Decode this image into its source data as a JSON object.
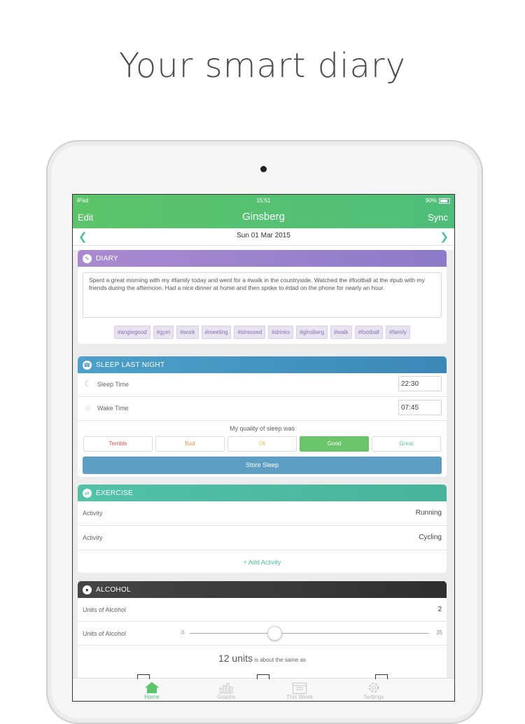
{
  "headline": "Your smart diary",
  "status_bar": {
    "carrier": "iPad",
    "time": "15:51",
    "battery": "90%"
  },
  "nav": {
    "edit": "Edit",
    "title": "Ginsberg",
    "sync": "Sync",
    "date": "Sun 01 Mar 2015"
  },
  "diary": {
    "title": "DIARY",
    "text": "Spent a great morning with my #family today and went for a #walk in the countryside. Watched the #football at the #pub with my friends during the afternoon. Had a nice dinner at home and then spoke to #dad on the phone for nearly an hour.",
    "tags": [
      "#angiegood",
      "#gym",
      "#work",
      "#meeting",
      "#stressed",
      "#drinks",
      "#ginsberg",
      "#walk",
      "#football",
      "#family"
    ]
  },
  "sleep": {
    "title": "SLEEP LAST NIGHT",
    "sleep_time_label": "Sleep Time",
    "sleep_time": "22:30",
    "wake_time_label": "Wake Time",
    "wake_time": "07:45",
    "quality_label": "My quality of sleep was",
    "options": [
      {
        "label": "Terrible",
        "color": "#d9534f",
        "selected": false
      },
      {
        "label": "Bad",
        "color": "#e89a4a",
        "selected": false
      },
      {
        "label": "Ok",
        "color": "#d6c94a",
        "selected": false
      },
      {
        "label": "Good",
        "color": "#6cc46a",
        "selected": true
      },
      {
        "label": "Great",
        "color": "#5cbf9a",
        "selected": false
      }
    ],
    "store_button": "Store Sleep"
  },
  "exercise": {
    "title": "EXERCISE",
    "activities": [
      {
        "label": "Activity",
        "value": "Running"
      },
      {
        "label": "Activity",
        "value": "Cycling"
      }
    ],
    "add_activity": "+ Add Activity"
  },
  "alcohol": {
    "title": "ALCOHOL",
    "units_label": "Units of Alcohol",
    "units_value": "2",
    "slider_label": "Units of Alcohol",
    "slider_min": "0",
    "slider_max": "35",
    "slider_value": 12,
    "units_big": "12 units",
    "units_suffix": " is about the same as"
  },
  "tabs": [
    {
      "label": "Home",
      "icon": "home-icon",
      "active": true
    },
    {
      "label": "Graphs",
      "icon": "graphs-icon",
      "active": false
    },
    {
      "label": "This Week",
      "icon": "calendar-icon",
      "active": false
    },
    {
      "label": "Settings",
      "icon": "gear-icon",
      "active": false
    }
  ],
  "colors": {
    "accent_green": "#5cc46a",
    "diary": "#9a80cf",
    "sleep": "#4595c0",
    "exercise": "#4dba9f",
    "alcohol": "#333333"
  }
}
